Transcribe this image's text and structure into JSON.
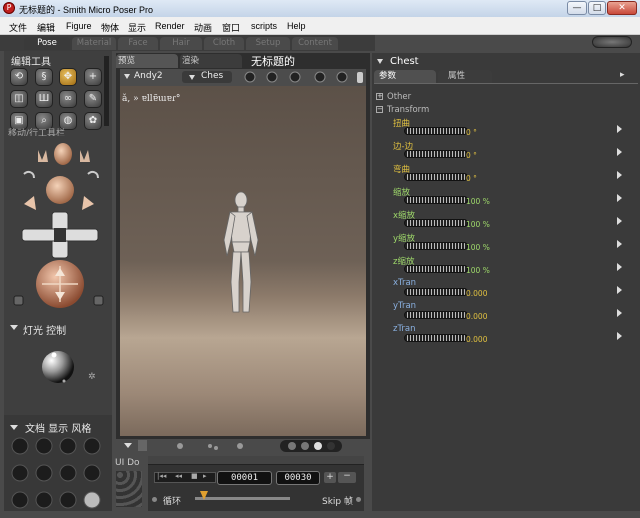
{
  "window": {
    "title": "无标题的 - Smith Micro Poser Pro",
    "icon": "poser-app-icon"
  },
  "window_controls": {
    "minimize": "—",
    "maximize": "□",
    "close": "✕"
  },
  "menu": [
    "文件",
    "编辑",
    "Figure",
    "物体",
    "显示",
    "Render",
    "动画",
    "窗口",
    "scripts",
    "Help"
  ],
  "rooms": [
    "Pose",
    "Material",
    "Face",
    "Hair",
    "Cloth",
    "Setup",
    "Content"
  ],
  "active_room": "Pose",
  "left_panel": {
    "editing_tools_label": "编辑工具",
    "truncated_label": "移动/行工具栏",
    "light_controls_label": "灯光 控制",
    "document_display_label": "文档 显示 风格",
    "uido_label": "UI Do"
  },
  "viewport": {
    "tabs": [
      "预览",
      "渲染"
    ],
    "document_title": "无标题的",
    "figure_select": "Andy2",
    "actor_select": "Ches",
    "overlay_text": "ǎ, » ɐllɐ̃ɯɐɾ°"
  },
  "playback": {
    "frame_current": "00001",
    "frame_total": "00030",
    "loop_label": "循环",
    "skip_label": "Skip 帧"
  },
  "parameters": {
    "actor": "Chest",
    "tabs": [
      "参数",
      "属性"
    ],
    "groups": [
      "Other",
      "Transform"
    ],
    "rows": [
      {
        "label": "扭曲",
        "value": "0 °",
        "color": "yellow"
      },
      {
        "label": "边-边",
        "value": "0 °",
        "color": "yellow"
      },
      {
        "label": "弯曲",
        "value": "0 °",
        "color": "yellow"
      },
      {
        "label": "缩放",
        "value": "100 %",
        "color": "green"
      },
      {
        "label": "x缩放",
        "value": "100 %",
        "color": "green"
      },
      {
        "label": "y缩放",
        "value": "100 %",
        "color": "green"
      },
      {
        "label": "z缩放",
        "value": "100 %",
        "color": "green"
      },
      {
        "label": "xTran",
        "value": "0.000",
        "color": "blue"
      },
      {
        "label": "yTran",
        "value": "0.000",
        "color": "blue"
      },
      {
        "label": "zTran",
        "value": "0.000",
        "color": "blue"
      }
    ]
  },
  "colors": {
    "label_yellow": "#e0c040",
    "label_green": "#9ed86a",
    "label_blue": "#8ab0e0",
    "panel_bg": "#3a3a3a"
  }
}
